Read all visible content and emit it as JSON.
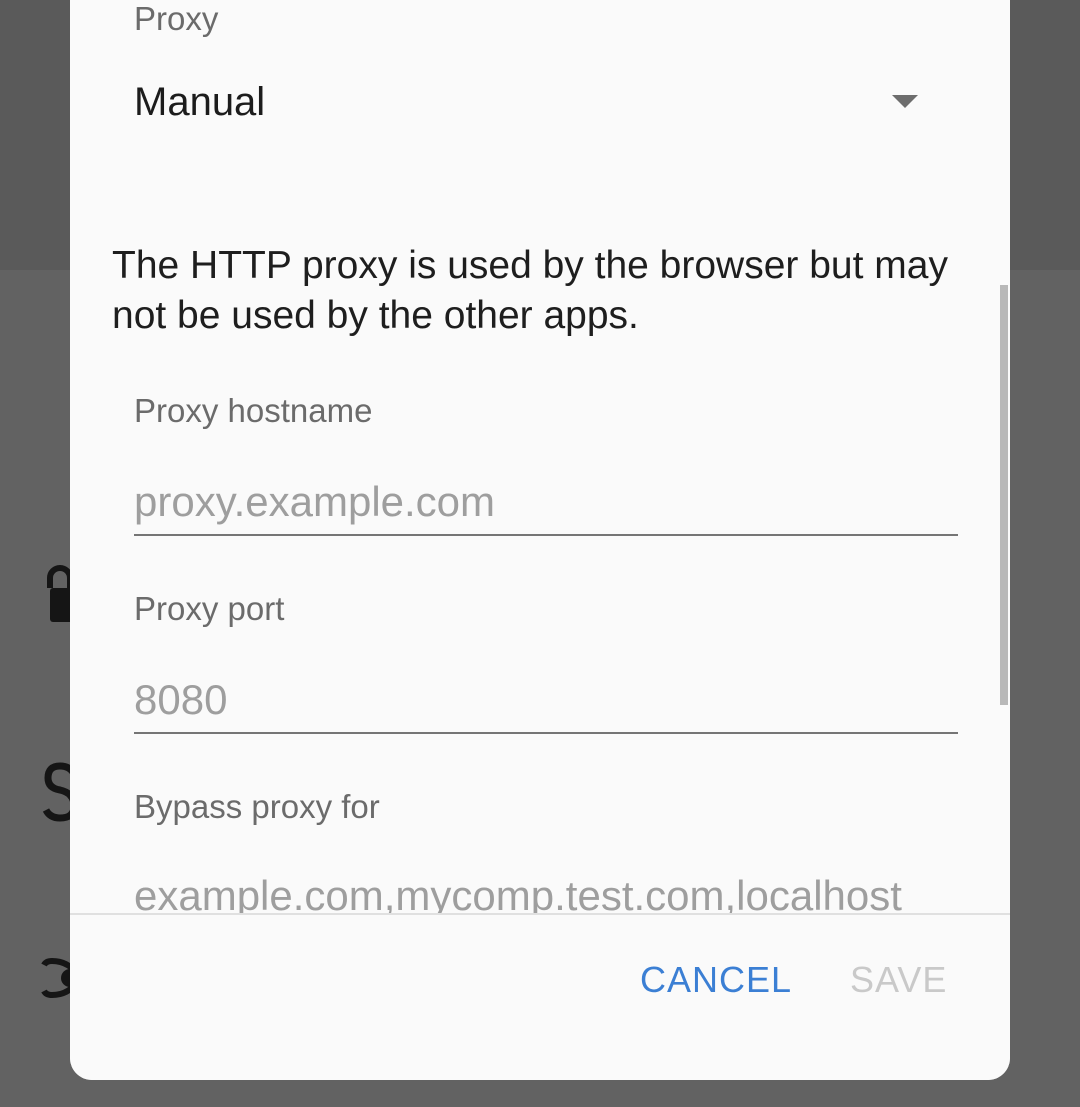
{
  "dialog": {
    "proxy_label": "Proxy",
    "proxy_value": "Manual",
    "info_text": "The HTTP proxy is used by the browser but may not be used by the other apps.",
    "hostname": {
      "label": "Proxy hostname",
      "placeholder": "proxy.example.com"
    },
    "port": {
      "label": "Proxy port",
      "placeholder": "8080"
    },
    "bypass": {
      "label": "Bypass proxy for",
      "placeholder": "example.com,mycomp.test.com,localhost"
    },
    "actions": {
      "cancel_label": "CANCEL",
      "save_label": "SAVE"
    }
  },
  "background_icons": [
    "lock-icon",
    "dollar-icon",
    "eye-icon"
  ],
  "colors": {
    "accent": "#3b7fd4",
    "disabled": "#c9c9c9",
    "scrim": "#5f5f5f",
    "surface": "#fafafa"
  }
}
